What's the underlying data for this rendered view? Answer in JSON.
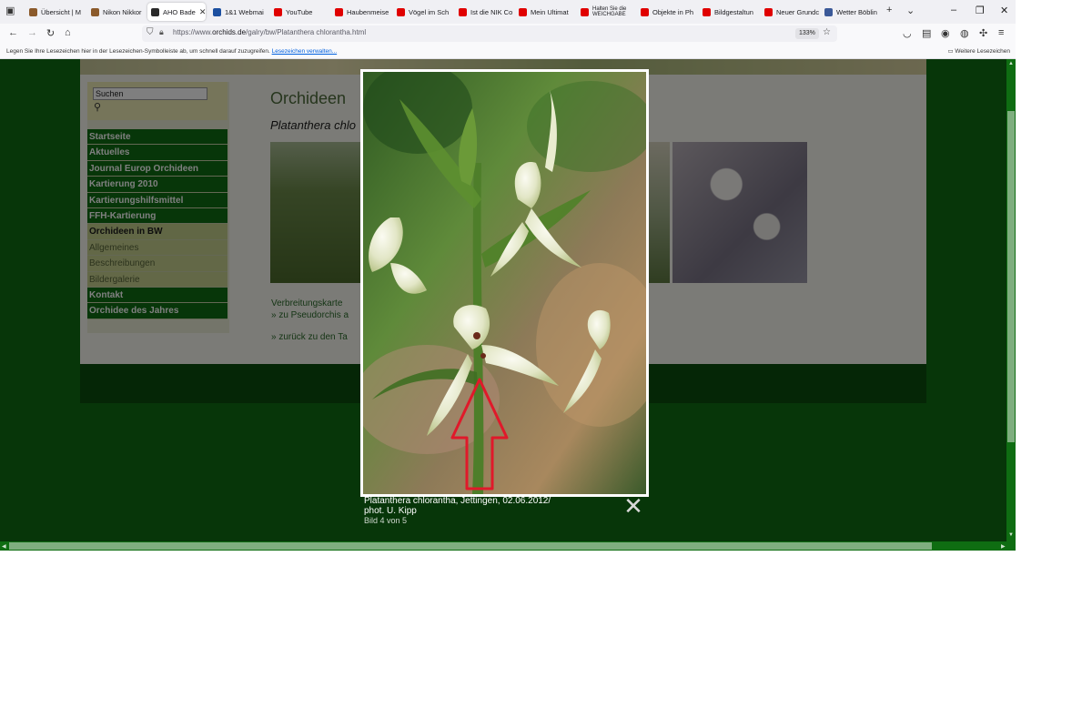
{
  "browser": {
    "tabs": [
      {
        "label": "Übersicht | M",
        "color": "#8b5a2b"
      },
      {
        "label": "Nikon Nikkor",
        "color": "#8b5a2b"
      },
      {
        "label": "AHO Bade",
        "color": "#2a2a2a",
        "active": true
      },
      {
        "label": "1&1 Webmai",
        "color": "#1c4fa0"
      },
      {
        "label": "YouTube",
        "color": "#e00000"
      },
      {
        "label": "Haubenmeise",
        "color": "#e00000"
      },
      {
        "label": "Vögel im Sch",
        "color": "#e00000"
      },
      {
        "label": "Ist die NIK Co",
        "color": "#e00000"
      },
      {
        "label": "Mein Ultimat",
        "color": "#e00000"
      },
      {
        "label": "Halten Sie die",
        "sub": "WEICHGABE",
        "color": "#e00000"
      },
      {
        "label": "Objekte in Ph",
        "color": "#e00000"
      },
      {
        "label": "Bildgestaltun",
        "color": "#e00000"
      },
      {
        "label": "Neuer Grundc",
        "color": "#e00000"
      },
      {
        "label": "Wetter Böblin",
        "color": "#3b5998"
      }
    ],
    "url_prefix": "https://www.",
    "url_domain": "orchids.de",
    "url_path": "/galry/bw/Platanthera chlorantha.html",
    "zoom": "133%",
    "bookmarks_hint": "Legen Sie Ihre Lesezeichen hier in der Lesezeichen-Symbolleiste ab, um schnell darauf zuzugreifen.",
    "bookmarks_link": "Lesezeichen verwalten...",
    "bookmarks_more": "Weitere Lesezeichen"
  },
  "site": {
    "search_value": "Suchen",
    "menu": [
      {
        "label": "Startseite",
        "style": "green"
      },
      {
        "label": "Aktuelles",
        "style": "green"
      },
      {
        "label": "Journal Europ Orchideen",
        "style": "green"
      },
      {
        "label": "Kartierung 2010",
        "style": "green"
      },
      {
        "label": "Kartierungshilfsmittel",
        "style": "green"
      },
      {
        "label": "FFH-Kartierung",
        "style": "green"
      },
      {
        "label": "Orchideen in BW",
        "style": "active"
      },
      {
        "label": "Allgemeines",
        "style": "sub"
      },
      {
        "label": "Beschreibungen",
        "style": "sub"
      },
      {
        "label": "Bildergalerie",
        "style": "sub"
      },
      {
        "label": "Kontakt",
        "style": "green"
      },
      {
        "label": "Orchidee des Jahres",
        "style": "green"
      }
    ],
    "heading": "Orchideen",
    "subtitle": "Platanthera chlo",
    "link_map": "Verbreitungskarte",
    "link_pseudorchis": "» zu Pseudorchis a",
    "link_back": "» zurück zu den Ta"
  },
  "lightbox": {
    "caption_line1": "Platanthera chlorantha, Jettingen, 02.06.2012/",
    "caption_line2": "phot. U. Kipp",
    "counter": "Bild 4 von 5",
    "close_glyph": "✕"
  },
  "colors": {
    "site_green": "#0f6d12",
    "annotation_arrow": "#e0192a"
  }
}
